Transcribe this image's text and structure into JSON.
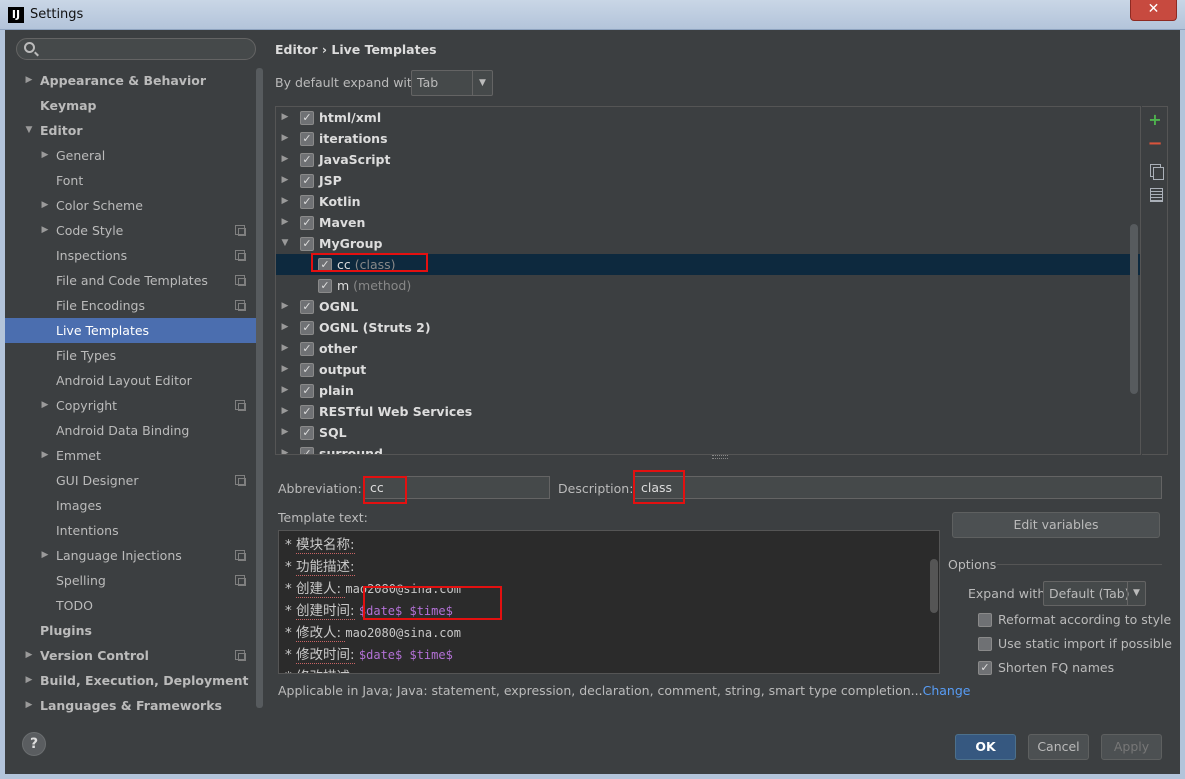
{
  "window": {
    "title": "Settings",
    "app_icon": "IJ",
    "close_glyph": "✕"
  },
  "sidebar": {
    "search": {
      "value": "",
      "placeholder": ""
    },
    "items": [
      {
        "label": "Appearance & Behavior",
        "level": 0,
        "arrow": "▶",
        "bold": true,
        "project": false,
        "selected": false
      },
      {
        "label": "Keymap",
        "level": 0,
        "arrow": "",
        "bold": true,
        "project": false,
        "selected": false
      },
      {
        "label": "Editor",
        "level": 0,
        "arrow": "▼",
        "bold": true,
        "project": false,
        "selected": false
      },
      {
        "label": "General",
        "level": 1,
        "arrow": "▶",
        "bold": false,
        "project": false,
        "selected": false
      },
      {
        "label": "Font",
        "level": 1,
        "arrow": "",
        "bold": false,
        "project": false,
        "selected": false
      },
      {
        "label": "Color Scheme",
        "level": 1,
        "arrow": "▶",
        "bold": false,
        "project": false,
        "selected": false
      },
      {
        "label": "Code Style",
        "level": 1,
        "arrow": "▶",
        "bold": false,
        "project": true,
        "selected": false
      },
      {
        "label": "Inspections",
        "level": 1,
        "arrow": "",
        "bold": false,
        "project": true,
        "selected": false
      },
      {
        "label": "File and Code Templates",
        "level": 1,
        "arrow": "",
        "bold": false,
        "project": true,
        "selected": false
      },
      {
        "label": "File Encodings",
        "level": 1,
        "arrow": "",
        "bold": false,
        "project": true,
        "selected": false
      },
      {
        "label": "Live Templates",
        "level": 1,
        "arrow": "",
        "bold": false,
        "project": false,
        "selected": true
      },
      {
        "label": "File Types",
        "level": 1,
        "arrow": "",
        "bold": false,
        "project": false,
        "selected": false
      },
      {
        "label": "Android Layout Editor",
        "level": 1,
        "arrow": "",
        "bold": false,
        "project": false,
        "selected": false
      },
      {
        "label": "Copyright",
        "level": 1,
        "arrow": "▶",
        "bold": false,
        "project": true,
        "selected": false
      },
      {
        "label": "Android Data Binding",
        "level": 1,
        "arrow": "",
        "bold": false,
        "project": false,
        "selected": false
      },
      {
        "label": "Emmet",
        "level": 1,
        "arrow": "▶",
        "bold": false,
        "project": false,
        "selected": false
      },
      {
        "label": "GUI Designer",
        "level": 1,
        "arrow": "",
        "bold": false,
        "project": true,
        "selected": false
      },
      {
        "label": "Images",
        "level": 1,
        "arrow": "",
        "bold": false,
        "project": false,
        "selected": false
      },
      {
        "label": "Intentions",
        "level": 1,
        "arrow": "",
        "bold": false,
        "project": false,
        "selected": false
      },
      {
        "label": "Language Injections",
        "level": 1,
        "arrow": "▶",
        "bold": false,
        "project": true,
        "selected": false
      },
      {
        "label": "Spelling",
        "level": 1,
        "arrow": "",
        "bold": false,
        "project": true,
        "selected": false
      },
      {
        "label": "TODO",
        "level": 1,
        "arrow": "",
        "bold": false,
        "project": false,
        "selected": false
      },
      {
        "label": "Plugins",
        "level": 0,
        "arrow": "",
        "bold": true,
        "project": false,
        "selected": false
      },
      {
        "label": "Version Control",
        "level": 0,
        "arrow": "▶",
        "bold": true,
        "project": true,
        "selected": false
      },
      {
        "label": "Build, Execution, Deployment",
        "level": 0,
        "arrow": "▶",
        "bold": true,
        "project": false,
        "selected": false
      },
      {
        "label": "Languages & Frameworks",
        "level": 0,
        "arrow": "▶",
        "bold": true,
        "project": false,
        "selected": false
      }
    ]
  },
  "help_label": "?",
  "main": {
    "breadcrumb": "Editor › Live Templates",
    "expand_label": "By default expand with",
    "expand_value": "Tab",
    "dropdown_glyph": "▼",
    "templates": [
      {
        "name": "html/xml",
        "desc": "",
        "group": true,
        "arrow": "▶",
        "checked": true
      },
      {
        "name": "iterations",
        "desc": "",
        "group": true,
        "arrow": "▶",
        "checked": true
      },
      {
        "name": "JavaScript",
        "desc": "",
        "group": true,
        "arrow": "▶",
        "checked": true
      },
      {
        "name": "JSP",
        "desc": "",
        "group": true,
        "arrow": "▶",
        "checked": true
      },
      {
        "name": "Kotlin",
        "desc": "",
        "group": true,
        "arrow": "▶",
        "checked": true
      },
      {
        "name": "Maven",
        "desc": "",
        "group": true,
        "arrow": "▶",
        "checked": true
      },
      {
        "name": "MyGroup",
        "desc": "",
        "group": true,
        "arrow": "▼",
        "checked": true
      },
      {
        "name": "cc",
        "desc": "(class)",
        "group": false,
        "arrow": "",
        "checked": true,
        "selected": true
      },
      {
        "name": "m",
        "desc": "(method)",
        "group": false,
        "arrow": "",
        "checked": true
      },
      {
        "name": "OGNL",
        "desc": "",
        "group": true,
        "arrow": "▶",
        "checked": true
      },
      {
        "name": "OGNL (Struts 2)",
        "desc": "",
        "group": true,
        "arrow": "▶",
        "checked": true
      },
      {
        "name": "other",
        "desc": "",
        "group": true,
        "arrow": "▶",
        "checked": true
      },
      {
        "name": "output",
        "desc": "",
        "group": true,
        "arrow": "▶",
        "checked": true
      },
      {
        "name": "plain",
        "desc": "",
        "group": true,
        "arrow": "▶",
        "checked": true
      },
      {
        "name": "RESTful Web Services",
        "desc": "",
        "group": true,
        "arrow": "▶",
        "checked": true
      },
      {
        "name": "SQL",
        "desc": "",
        "group": true,
        "arrow": "▶",
        "checked": true
      },
      {
        "name": "surround",
        "desc": "",
        "group": true,
        "arrow": "▶",
        "checked": true
      }
    ],
    "toolbar": {
      "add_glyph": "+",
      "remove_glyph": "−"
    },
    "abbreviation_label": "Abbreviation:",
    "abbreviation_value": "cc",
    "description_label": "Description:",
    "description_value": "class",
    "template_text_label": "Template text:",
    "template_lines": [
      {
        "prefix": "* ",
        "text": "模块名称:",
        "rest": "",
        "rest_kind": ""
      },
      {
        "prefix": "* ",
        "text": "功能描述:",
        "rest": "",
        "rest_kind": ""
      },
      {
        "prefix": "* ",
        "text": "创建人: ",
        "rest": "mao2080@sina.com",
        "rest_kind": "mail"
      },
      {
        "prefix": "* ",
        "text": "创建时间:",
        "rest": "$date$ $time$",
        "rest_kind": "var"
      },
      {
        "prefix": "* ",
        "text": "修改人: ",
        "rest": "mao2080@sina.com",
        "rest_kind": "mail"
      },
      {
        "prefix": "* ",
        "text": "修改时间:",
        "rest": "$date$ $time$",
        "rest_kind": "var"
      },
      {
        "prefix": "* ",
        "text": "修改描述:",
        "rest": "",
        "rest_kind": ""
      }
    ],
    "applicable_text": "Applicable in Java; Java: statement, expression, declaration, comment, string, smart type completion...",
    "change_link": "Change",
    "edit_variables_label": "Edit variables",
    "options": {
      "title": "Options",
      "expand_with_label": "Expand with",
      "expand_with_value": "Default (Tab)",
      "checkboxes": [
        {
          "label": "Reformat according to style",
          "checked": false
        },
        {
          "label": "Use static import if possible",
          "checked": false
        },
        {
          "label": "Shorten FQ names",
          "checked": true
        }
      ]
    }
  },
  "buttons": {
    "ok": "OK",
    "cancel": "Cancel",
    "apply": "Apply"
  },
  "colors": {
    "accent": "#4b6eaf",
    "highlight_box": "#e31010",
    "tree_selection": "#0d293e"
  }
}
